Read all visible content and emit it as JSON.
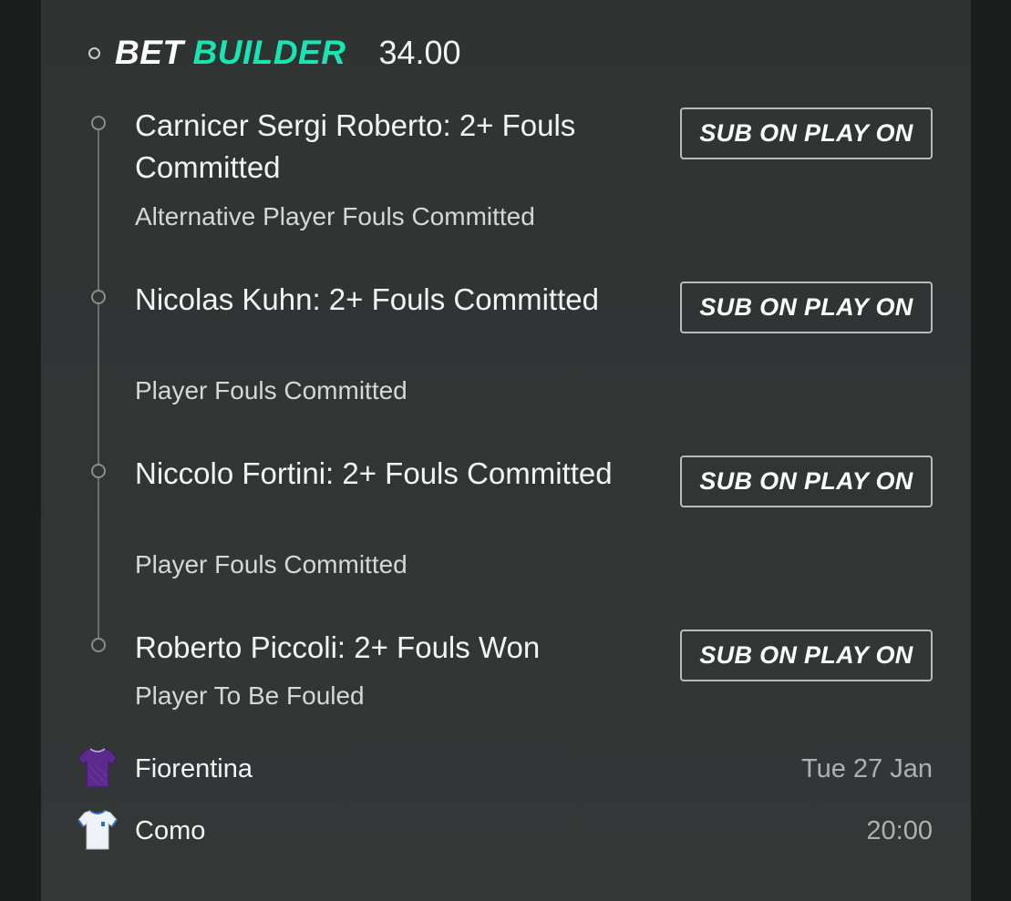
{
  "bet_builder": {
    "label_bet": "BET",
    "label_builder": "BUILDER",
    "odds": "34.00",
    "brand_color": "#19e5b2"
  },
  "legs": [
    {
      "title": "Carnicer Sergi Roberto: 2+ Fouls Committed",
      "market": "Alternative Player Fouls Committed",
      "button_label": "SUB ON PLAY ON"
    },
    {
      "title": "Nicolas Kuhn: 2+ Fouls Committed",
      "market": "Player Fouls Committed",
      "button_label": "SUB ON PLAY ON"
    },
    {
      "title": "Niccolo Fortini: 2+ Fouls Committed",
      "market": "Player Fouls Committed",
      "button_label": "SUB ON PLAY ON"
    },
    {
      "title": "Roberto Piccoli: 2+ Fouls Won",
      "market": "Player To Be Fouled",
      "button_label": "SUB ON PLAY ON"
    }
  ],
  "match": {
    "home": {
      "name": "Fiorentina",
      "icon": "purple-shirt-icon",
      "shirt_color": "#5b2a8c"
    },
    "away": {
      "name": "Como",
      "icon": "white-shirt-icon",
      "shirt_color": "#eef2f6"
    },
    "date": "Tue 27 Jan",
    "time": "20:00"
  }
}
